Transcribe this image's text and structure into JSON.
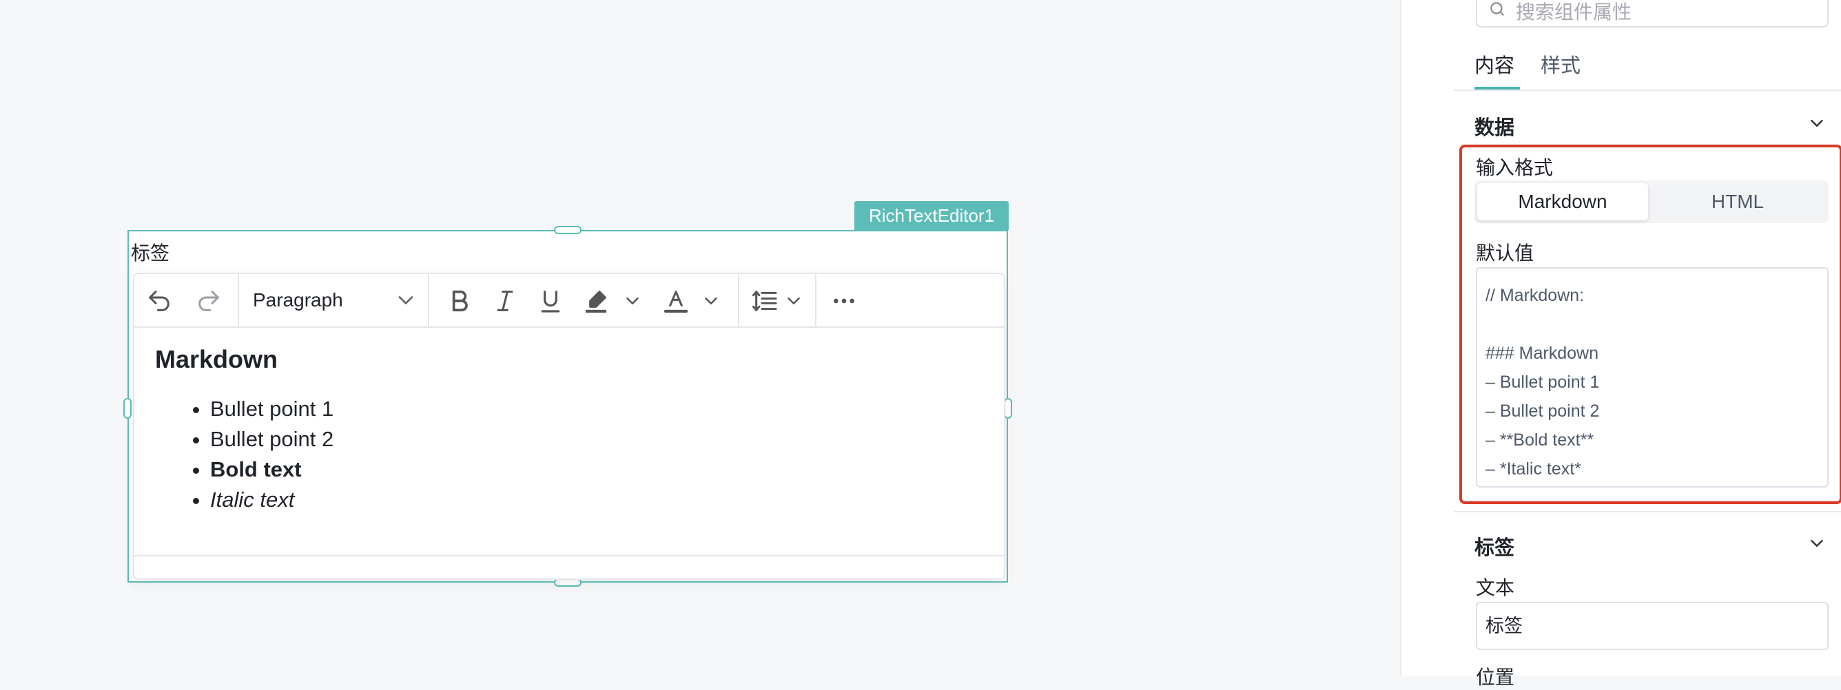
{
  "canvas": {
    "component_tag": "RichTextEditor1",
    "component_label": "标签",
    "toolbar": {
      "undo_icon": "undo-icon",
      "redo_icon": "redo-icon",
      "block_format": "Paragraph",
      "icons": [
        "bold-icon",
        "italic-icon",
        "underline-icon",
        "highlight-icon",
        "font-color-icon",
        "line-height-icon",
        "more-icon"
      ]
    },
    "content": {
      "heading": "Markdown",
      "bullets": [
        "Bullet point 1",
        "Bullet point 2",
        "Bold text",
        "Italic text"
      ]
    }
  },
  "panel": {
    "search_placeholder": "搜索组件属性",
    "tabs": [
      "内容",
      "样式"
    ],
    "data_section": {
      "title": "数据",
      "input_format_label": "输入格式",
      "formats": [
        "Markdown",
        "HTML"
      ],
      "selected_format": "Markdown",
      "default_value_label": "默认值",
      "default_value": "// Markdown:\n\n### Markdown\n– Bullet point 1\n– Bullet point 2\n– **Bold text**\n– *Italic text*"
    },
    "label_section": {
      "title": "标签",
      "text_label": "文本",
      "text_value": "标签",
      "next_label": "位置"
    }
  },
  "colors": {
    "accent": "#5cbcb8",
    "highlight_border": "#d93a26"
  }
}
